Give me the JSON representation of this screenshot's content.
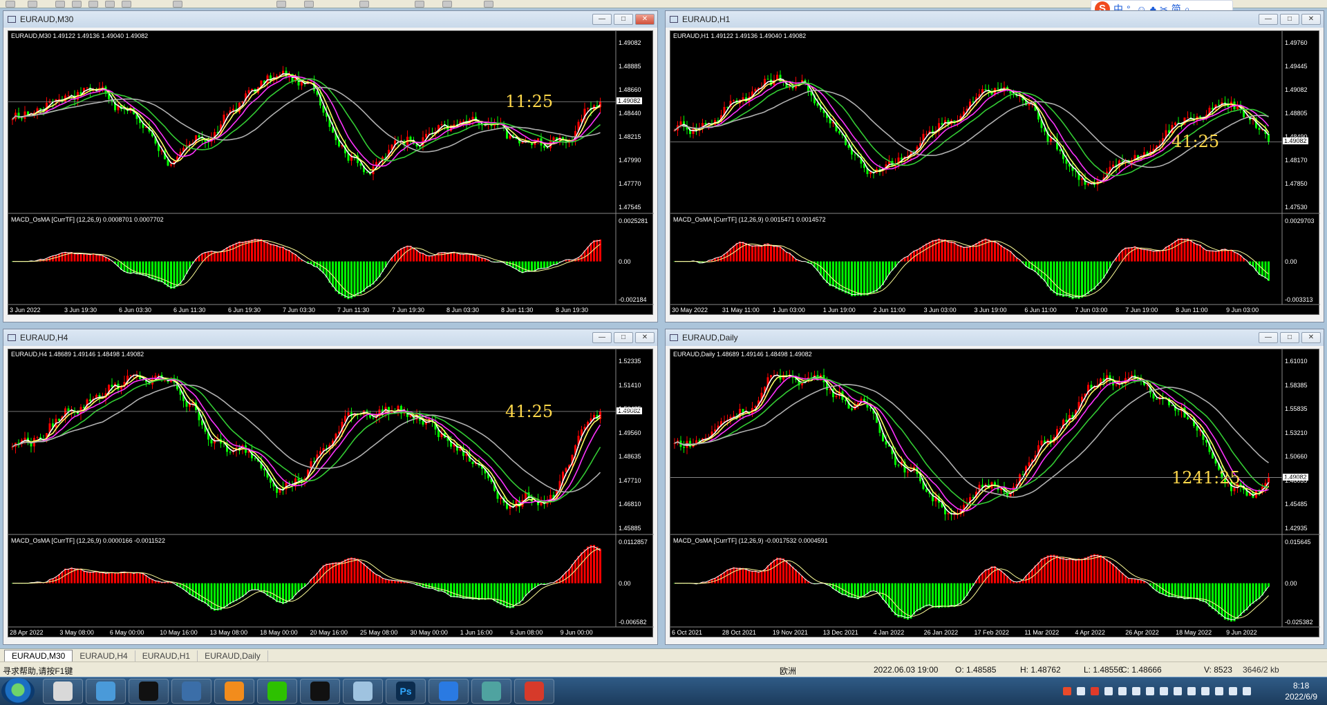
{
  "ime": {
    "logo": "S",
    "items": [
      "中",
      "°,",
      "☺",
      "♣",
      "✂",
      "简",
      "⌕"
    ]
  },
  "windows": [
    {
      "id": "m30",
      "title": "EURAUD,M30",
      "info": "EURAUD,M30  1.49122 1.49136 1.49040 1.49082",
      "timer": "11:25",
      "price_tag": "1.49082",
      "price_axis": [
        "1.49082",
        "1.48885",
        "1.48660",
        "1.48440",
        "1.48215",
        "1.47990",
        "1.47770",
        "1.47545"
      ],
      "macd_info": "MACD_OsMA [CurrTF] (12,26,9) 0.0008701 0.0007702",
      "macd_axis": [
        "0.0025281",
        "0.00",
        "-0.002184"
      ],
      "time_axis": [
        "3 Jun 2022",
        "3 Jun 19:30",
        "6 Jun 03:30",
        "6 Jun 11:30",
        "6 Jun 19:30",
        "7 Jun 03:30",
        "7 Jun 11:30",
        "7 Jun 19:30",
        "8 Jun 03:30",
        "8 Jun 11:30",
        "8 Jun 19:30"
      ],
      "active": true
    },
    {
      "id": "h1",
      "title": "EURAUD,H1",
      "info": "EURAUD,H1  1.49122 1.49136 1.49040 1.49082",
      "timer": "41:25",
      "price_tag": "1.49082",
      "price_axis": [
        "1.49760",
        "1.49445",
        "1.49082",
        "1.48805",
        "1.48490",
        "1.48170",
        "1.47850",
        "1.47530"
      ],
      "macd_info": "MACD_OsMA [CurrTF] (12,26,9) 0.0015471 0.0014572",
      "macd_axis": [
        "0.0029703",
        "0.00",
        "-0.003313"
      ],
      "time_axis": [
        "30 May 2022",
        "31 May 11:00",
        "1 Jun 03:00",
        "1 Jun 19:00",
        "2 Jun 11:00",
        "3 Jun 03:00",
        "3 Jun 19:00",
        "6 Jun 11:00",
        "7 Jun 03:00",
        "7 Jun 19:00",
        "8 Jun 11:00",
        "9 Jun 03:00"
      ],
      "active": false
    },
    {
      "id": "h4",
      "title": "EURAUD,H4",
      "info": "EURAUD,H4  1.48689 1.49146 1.48498 1.49082",
      "timer": "41:25",
      "price_tag": "1.49082",
      "price_axis": [
        "1.52335",
        "1.51410",
        "1.50485",
        "1.49560",
        "1.48635",
        "1.47710",
        "1.46810",
        "1.45885"
      ],
      "macd_info": "MACD_OsMA [CurrTF] (12,26,9) 0.0000166 -0.0011522",
      "macd_axis": [
        "0.0112857",
        "0.00",
        "-0.006582"
      ],
      "time_axis": [
        "28 Apr 2022",
        "3 May 08:00",
        "6 May 00:00",
        "10 May 16:00",
        "13 May 08:00",
        "18 May 00:00",
        "20 May 16:00",
        "25 May 08:00",
        "30 May 00:00",
        "1 Jun 16:00",
        "6 Jun 08:00",
        "9 Jun 00:00"
      ],
      "active": false
    },
    {
      "id": "daily",
      "title": "EURAUD,Daily",
      "info": "EURAUD,Daily  1.48689 1.49146 1.48498 1.49082",
      "timer": "1241:25",
      "price_tag": "1.49082",
      "price_axis": [
        "1.61010",
        "1.58385",
        "1.55835",
        "1.53210",
        "1.50660",
        "1.48035",
        "1.45485",
        "1.42935"
      ],
      "macd_info": "MACD_OsMA [CurrTF] (12,26,9) -0.0017532 0.0004591",
      "macd_axis": [
        "0.015645",
        "0.00",
        "-0.025382"
      ],
      "time_axis": [
        "6 Oct 2021",
        "28 Oct 2021",
        "19 Nov 2021",
        "13 Dec 2021",
        "4 Jan 2022",
        "26 Jan 2022",
        "17 Feb 2022",
        "11 Mar 2022",
        "4 Apr 2022",
        "26 Apr 2022",
        "18 May 2022",
        "9 Jun 2022"
      ],
      "active": false
    }
  ],
  "tabs": [
    "EURAUD,M30",
    "EURAUD,H4",
    "EURAUD,H1",
    "EURAUD,Daily"
  ],
  "status": {
    "help": "寻求帮助,请按F1键",
    "profile": "欧洲",
    "time": "2022.06.03 19:00",
    "open": "O: 1.48585",
    "high": "H: 1.48762",
    "low": "L: 1.48556",
    "close": "C: 1.48666",
    "volume": "V: 8523",
    "traffic": "3646/2 kb"
  },
  "clock": {
    "time": "8:18",
    "date": "2022/6/9"
  },
  "taskbar": {
    "apps": [
      "paint-app",
      "pictures-app",
      "zenith-app",
      "monitor-app",
      "firefox-app",
      "wechat-app",
      "capcut-app",
      "notes-app",
      "photoshop-app",
      "pen-app",
      "trading-app",
      "wps-app"
    ],
    "ps_label": "Ps"
  },
  "colors": {
    "bull": "#ff0000",
    "bear": "#00ff00",
    "ma_fast": "#ffff66",
    "ma_white": "#ffffff",
    "ma_magenta": "#ff33ff",
    "ma_green": "#33cc33",
    "ma_gray": "#b0b0b0"
  }
}
